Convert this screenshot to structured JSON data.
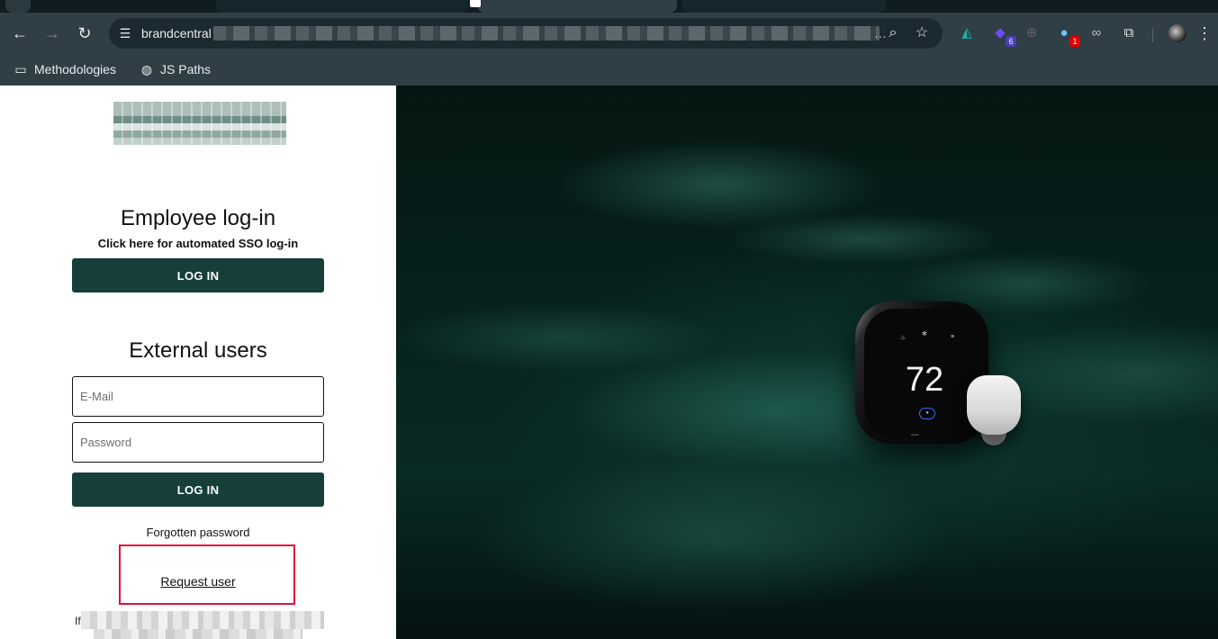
{
  "browser": {
    "url_prefix": "brandcentral",
    "url_ellipsis": "…",
    "extensions": [
      {
        "name": "flame-extension-icon",
        "glyph": "◭",
        "color": "#18b4a8"
      },
      {
        "name": "shape-extension-icon",
        "glyph": "◆",
        "color": "#6b4cff",
        "badge": "6",
        "badge_color": "#4b3fb8"
      },
      {
        "name": "crosshair-extension-icon",
        "glyph": "⊕",
        "color": "#5f6368"
      },
      {
        "name": "bulb-extension-icon",
        "glyph": "●",
        "color": "#6ec1ff",
        "badge": "1",
        "badge_color": "#e00000"
      },
      {
        "name": "link-extension-icon",
        "glyph": "∞",
        "color": "#bdc1c6"
      },
      {
        "name": "puzzle-extension-icon",
        "glyph": "⧉",
        "color": "#e8eaed"
      }
    ],
    "bookmarks": [
      {
        "label": "Methodologies",
        "icon": "folder-icon"
      },
      {
        "label": "JS Paths",
        "icon": "globe-icon"
      }
    ]
  },
  "login": {
    "employee_title": "Employee log-in",
    "sso_text": "Click here for automated SSO log-in",
    "sso_button": "LOG IN",
    "external_title": "External users",
    "email_placeholder": "E-Mail",
    "password_placeholder": "Password",
    "login_button": "LOG IN",
    "forgot_password": "Forgotten password",
    "request_user": "Request user",
    "footer_prefix": "If"
  },
  "hero": {
    "temperature": "72",
    "colors": {
      "accent": "#163f3a",
      "highlight": "#e0113a"
    }
  }
}
